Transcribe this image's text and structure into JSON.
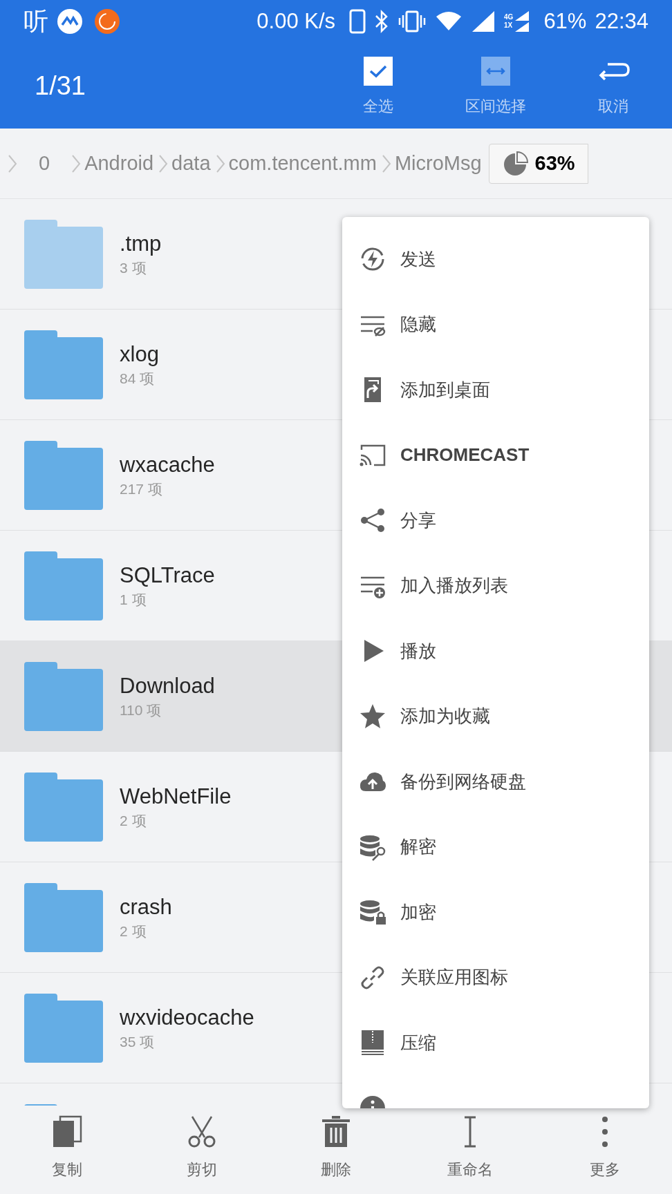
{
  "status_bar": {
    "app_glyph": "听",
    "speed": "0.00 K/s",
    "network_labels": [
      "4G",
      "1X"
    ],
    "battery": "61%",
    "time": "22:34"
  },
  "header": {
    "title": "1/31",
    "actions": [
      {
        "label": "全选",
        "kind": "select-all"
      },
      {
        "label": "区间选择",
        "kind": "range"
      },
      {
        "label": "取消",
        "kind": "cancel"
      }
    ]
  },
  "breadcrumb": {
    "items": [
      "0",
      "Android",
      "data",
      "com.tencent.mm",
      "MicroMsg"
    ],
    "storage": "63%"
  },
  "files": [
    {
      "name": ".tmp",
      "count": "3 项",
      "hidden": true,
      "selected": false
    },
    {
      "name": "xlog",
      "count": "84 项",
      "hidden": false,
      "selected": false
    },
    {
      "name": "wxacache",
      "count": "217 项",
      "hidden": false,
      "selected": false
    },
    {
      "name": "SQLTrace",
      "count": "1 项",
      "hidden": false,
      "selected": false
    },
    {
      "name": "Download",
      "count": "110 项",
      "hidden": false,
      "selected": true
    },
    {
      "name": "WebNetFile",
      "count": "2 项",
      "hidden": false,
      "selected": false
    },
    {
      "name": "crash",
      "count": "2 项",
      "hidden": false,
      "selected": false
    },
    {
      "name": "wxvideocache",
      "count": "35 项",
      "hidden": false,
      "selected": false
    }
  ],
  "menu": [
    {
      "label": "发送",
      "kind": "send",
      "bold": false
    },
    {
      "label": "隐藏",
      "kind": "hide",
      "bold": false
    },
    {
      "label": "添加到桌面",
      "kind": "shortcut",
      "bold": false
    },
    {
      "label": "CHROMECAST",
      "kind": "cast",
      "bold": true
    },
    {
      "label": "分享",
      "kind": "share",
      "bold": false
    },
    {
      "label": "加入播放列表",
      "kind": "playlist",
      "bold": false
    },
    {
      "label": "播放",
      "kind": "play",
      "bold": false
    },
    {
      "label": "添加为收藏",
      "kind": "star",
      "bold": false
    },
    {
      "label": "备份到网络硬盘",
      "kind": "cloud",
      "bold": false
    },
    {
      "label": "解密",
      "kind": "decrypt",
      "bold": false
    },
    {
      "label": "加密",
      "kind": "encrypt",
      "bold": false
    },
    {
      "label": "关联应用图标",
      "kind": "link",
      "bold": false
    },
    {
      "label": "压缩",
      "kind": "zip",
      "bold": false
    },
    {
      "kind": "info"
    }
  ],
  "toolbar": [
    {
      "label": "复制",
      "kind": "copy"
    },
    {
      "label": "剪切",
      "kind": "cut"
    },
    {
      "label": "删除",
      "kind": "delete"
    },
    {
      "label": "重命名",
      "kind": "rename"
    },
    {
      "label": "更多",
      "kind": "more"
    }
  ]
}
